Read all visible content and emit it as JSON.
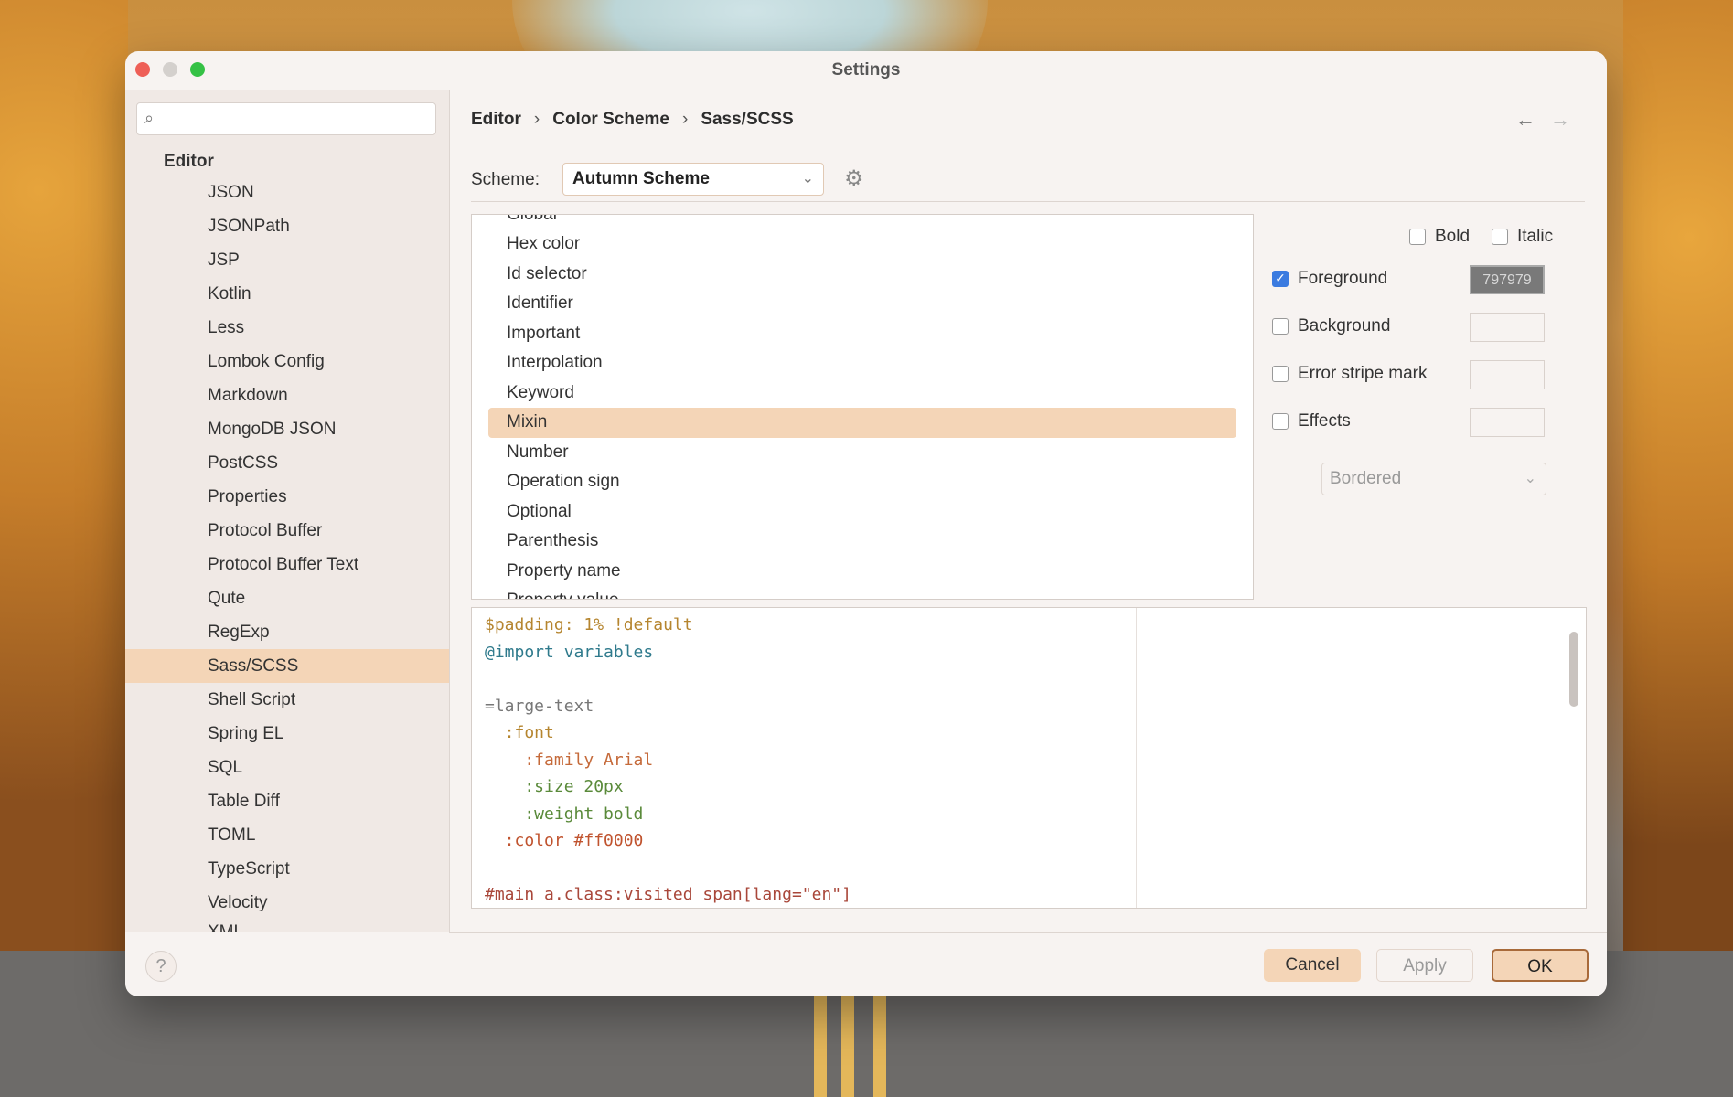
{
  "window": {
    "title": "Settings"
  },
  "sidebar": {
    "search_placeholder": "",
    "header": "Editor",
    "items": [
      {
        "label": "JSON"
      },
      {
        "label": "JSONPath"
      },
      {
        "label": "JSP"
      },
      {
        "label": "Kotlin"
      },
      {
        "label": "Less"
      },
      {
        "label": "Lombok Config"
      },
      {
        "label": "Markdown"
      },
      {
        "label": "MongoDB JSON"
      },
      {
        "label": "PostCSS"
      },
      {
        "label": "Properties"
      },
      {
        "label": "Protocol Buffer"
      },
      {
        "label": "Protocol Buffer Text"
      },
      {
        "label": "Qute"
      },
      {
        "label": "RegExp"
      },
      {
        "label": "Sass/SCSS"
      },
      {
        "label": "Shell Script"
      },
      {
        "label": "Spring EL"
      },
      {
        "label": "SQL"
      },
      {
        "label": "Table Diff"
      },
      {
        "label": "TOML"
      },
      {
        "label": "TypeScript"
      },
      {
        "label": "Velocity"
      },
      {
        "label": "XML"
      }
    ],
    "selected": "Sass/SCSS"
  },
  "breadcrumb": [
    "Editor",
    "Color Scheme",
    "Sass/SCSS"
  ],
  "nav": {
    "back": "←",
    "forward": "→"
  },
  "scheme": {
    "label": "Scheme:",
    "value": "Autumn Scheme"
  },
  "attributes": {
    "top_cut": "Global",
    "items": [
      "Hex color",
      "Id selector",
      "Identifier",
      "Important",
      "Interpolation",
      "Keyword",
      "Mixin",
      "Number",
      "Operation sign",
      "Optional",
      "Parenthesis",
      "Property name"
    ],
    "bottom_cut": "Property value",
    "selected": "Mixin"
  },
  "properties": {
    "bold": "Bold",
    "italic": "Italic",
    "foreground": "Foreground",
    "foreground_color": "797979",
    "background": "Background",
    "error_stripe": "Error stripe mark",
    "effects": "Effects",
    "effect_type": "Bordered"
  },
  "preview": {
    "lines": [
      "$padding: 1% !default",
      "@import variables",
      "",
      "=large-text",
      "  :font",
      "    :family Arial",
      "    :size 20px",
      "    :weight bold",
      "  :color #ff0000",
      "",
      "#main a.class:visited span[lang=\"en\"]"
    ]
  },
  "buttons": {
    "help": "?",
    "cancel": "Cancel",
    "apply": "Apply",
    "ok": "OK"
  },
  "colors": {
    "accent_selection": "#f4d5b7",
    "checkbox_blue": "#3b7be0",
    "ok_border": "#a86a3a"
  }
}
